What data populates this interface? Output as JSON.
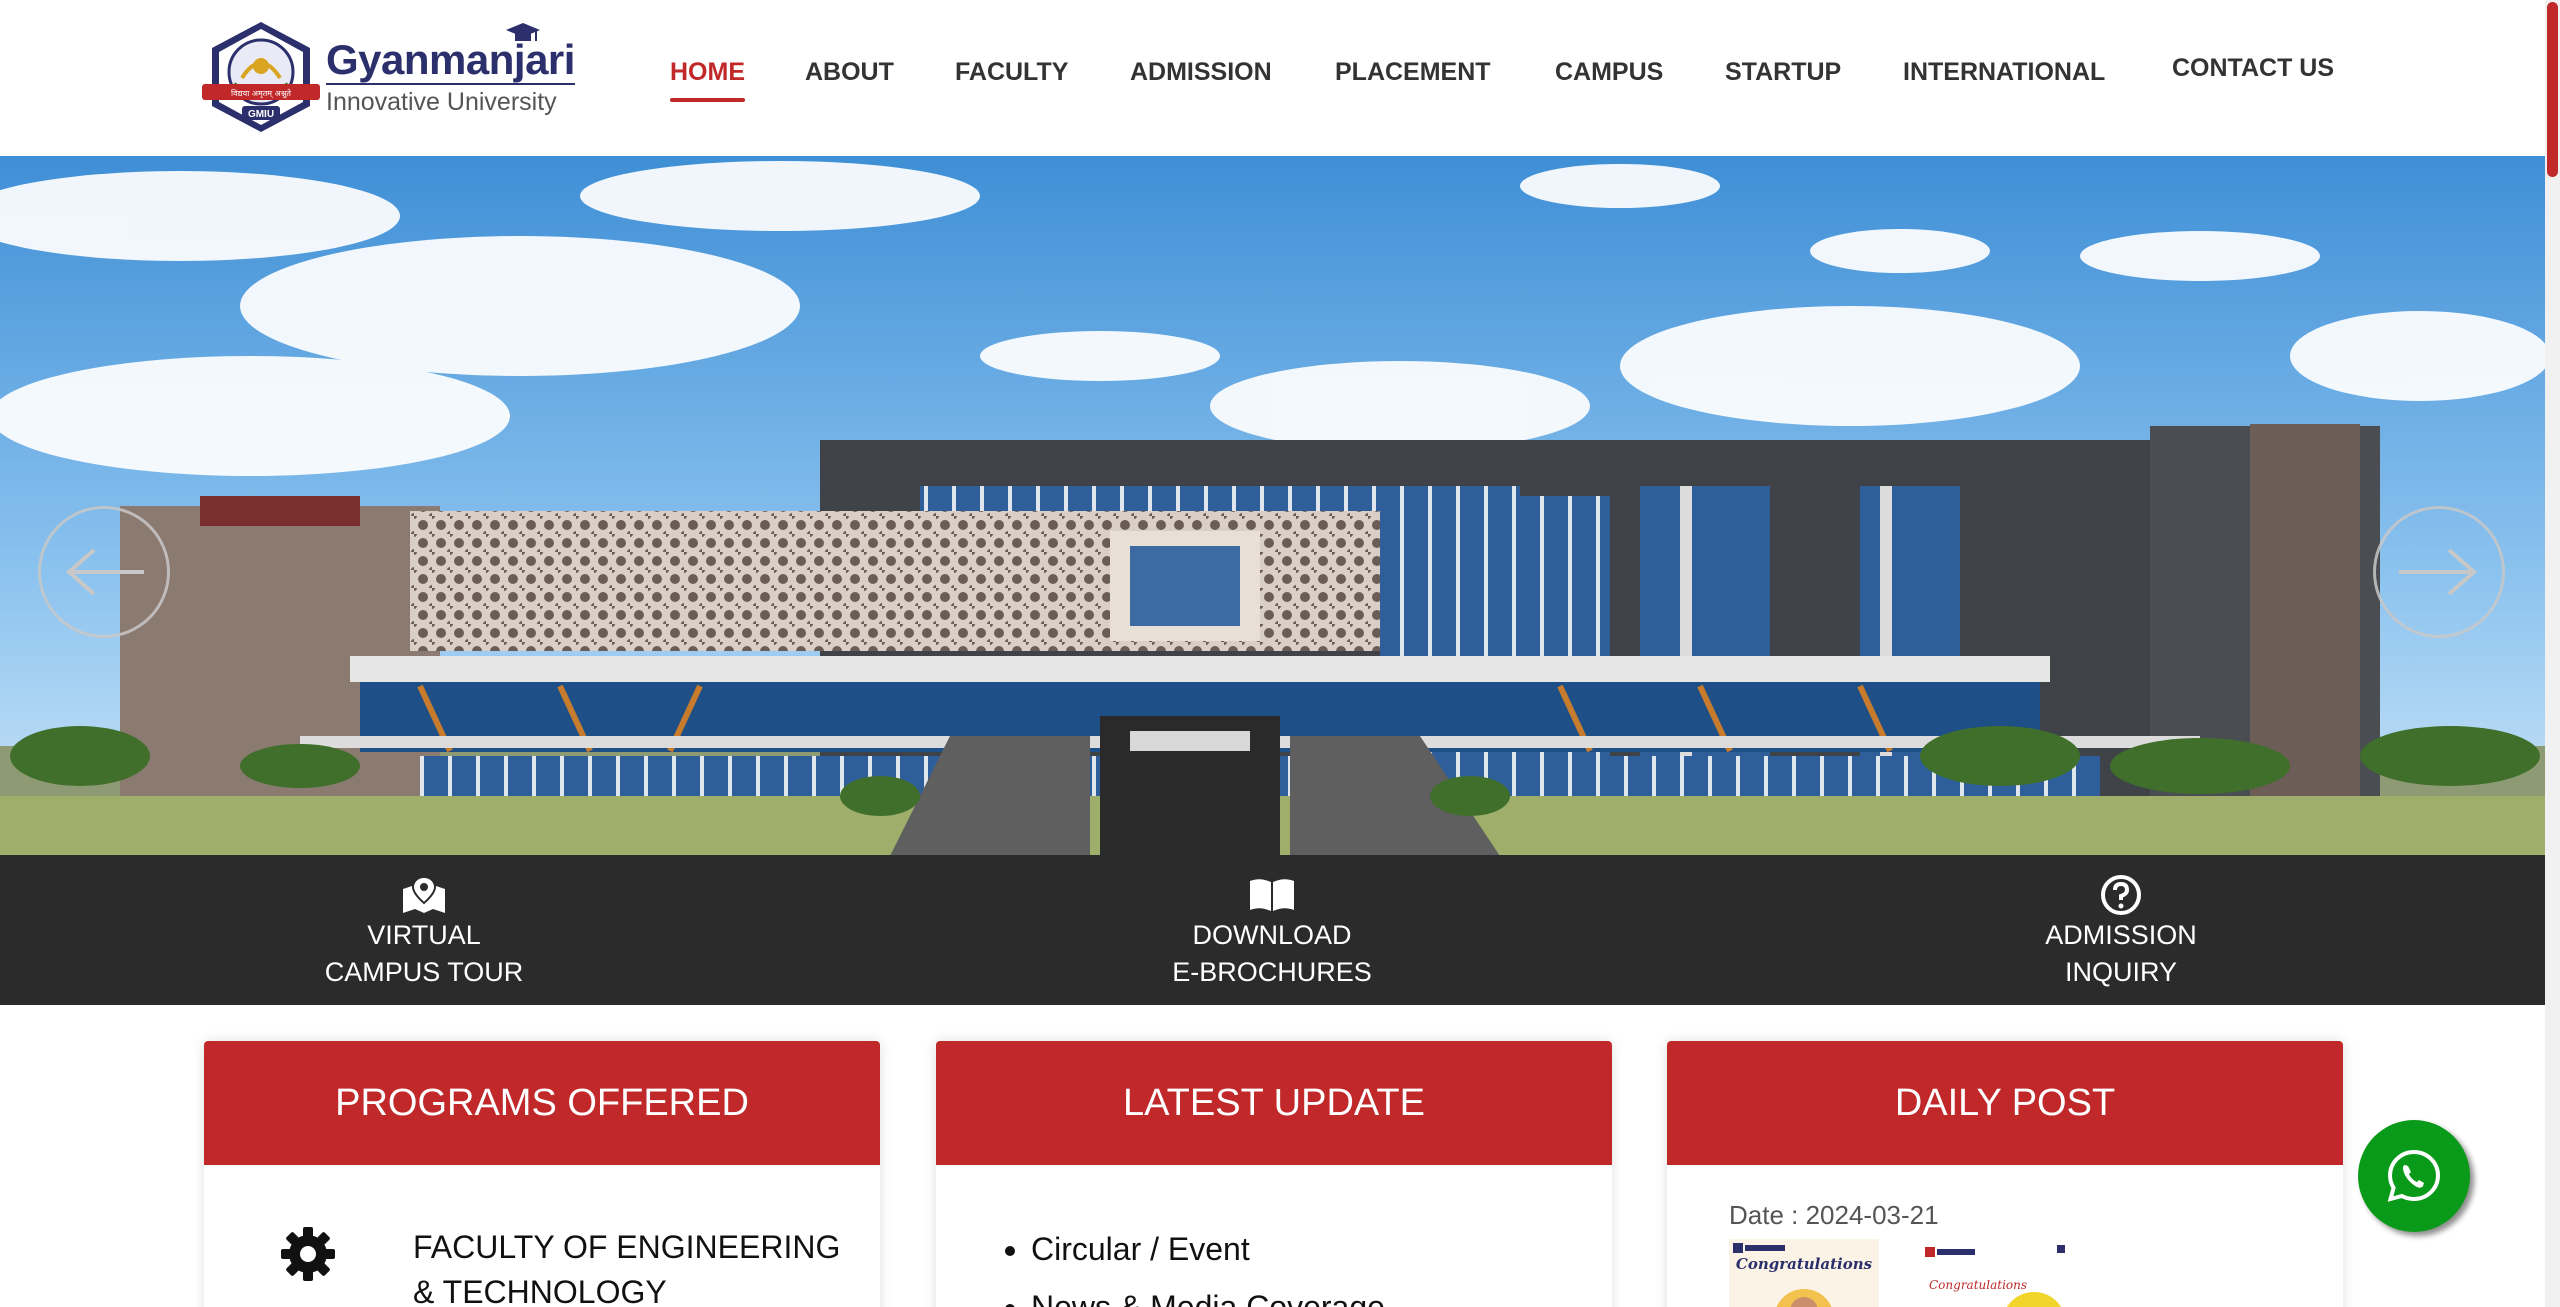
{
  "header": {
    "logo": {
      "name": "Gyanmanjari",
      "subtitle": "Innovative University",
      "seal_text": "GMIU",
      "motto": "विद्यया अमृतम् अश्नुते"
    },
    "nav": [
      {
        "label": "HOME",
        "active": true
      },
      {
        "label": "ABOUT",
        "active": false
      },
      {
        "label": "FACULTY",
        "active": false
      },
      {
        "label": "ADMISSION",
        "active": false
      },
      {
        "label": "PLACEMENT",
        "active": false
      },
      {
        "label": "CAMPUS",
        "active": false
      },
      {
        "label": "STARTUP",
        "active": false
      },
      {
        "label": "INTERNATIONAL",
        "active": false
      },
      {
        "label": "CONTACT US",
        "active": false
      }
    ]
  },
  "hero": {
    "prev_icon": "arrow-left-icon",
    "next_icon": "arrow-right-icon"
  },
  "quick_links": [
    {
      "line1": "VIRTUAL",
      "line2": "CAMPUS TOUR",
      "icon": "map-marker-icon"
    },
    {
      "line1": "DOWNLOAD",
      "line2": "E-BROCHURES",
      "icon": "book-open-icon"
    },
    {
      "line1": "ADMISSION",
      "line2": "INQUIRY",
      "icon": "question-circle-icon"
    }
  ],
  "cards": {
    "programs": {
      "title": "PROGRAMS OFFERED",
      "items": [
        {
          "label": "FACULTY OF ENGINEERING & TECHNOLOGY",
          "icon": "gear-icon"
        }
      ]
    },
    "updates": {
      "title": "LATEST UPDATE",
      "items": [
        "Circular / Event",
        "News & Media Coverage"
      ]
    },
    "daily_post": {
      "title": "DAILY POST",
      "date": "Date : 2024-03-21",
      "thumb_caption": "Congratulations"
    }
  },
  "colors": {
    "brand_red": "#c0282a",
    "dark_bar": "#2b2b2b",
    "whatsapp_green": "#0a9a1a",
    "logo_navy": "#2b2f6b"
  },
  "floating": {
    "whatsapp_icon": "whatsapp-icon"
  }
}
